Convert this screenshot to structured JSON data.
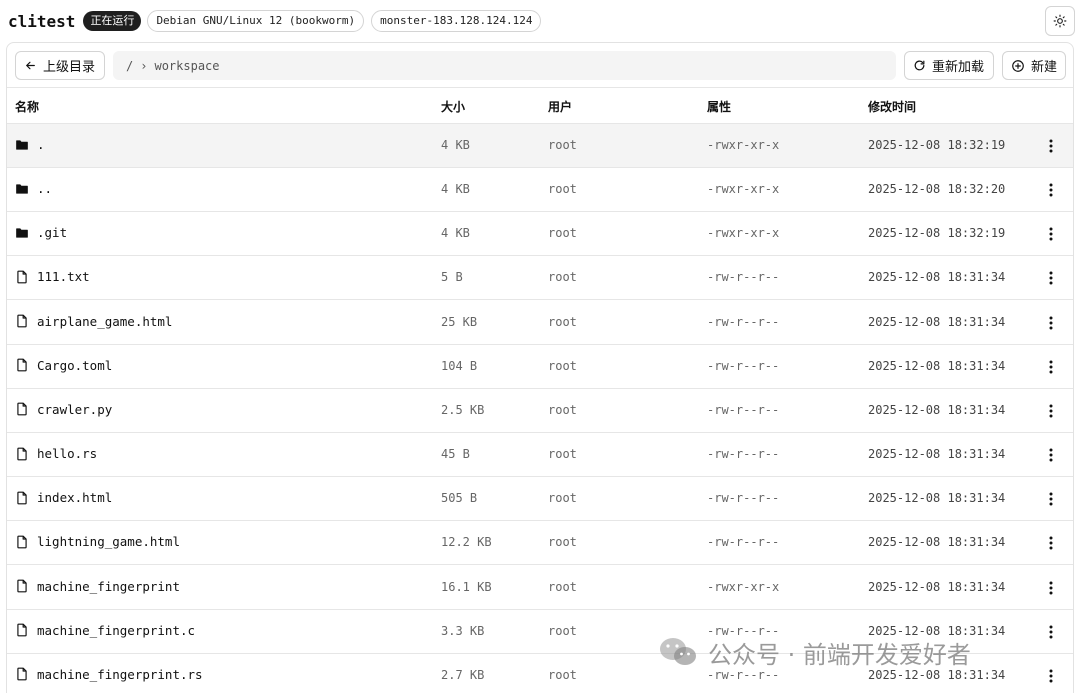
{
  "header": {
    "title": "clitest",
    "status": "正在运行",
    "os": "Debian GNU/Linux 12 (bookworm)",
    "host": "monster-183.128.124.124",
    "theme_icon": "sun-icon"
  },
  "toolbar": {
    "back_label": "上级目录",
    "path_root": "/",
    "path_separator": "›",
    "path_current": "workspace",
    "reload_label": "重新加载",
    "new_label": "新建"
  },
  "table": {
    "columns": [
      "名称",
      "大小",
      "用户",
      "属性",
      "修改时间"
    ],
    "rows": [
      {
        "type": "folder",
        "name": ".",
        "size": "4 KB",
        "user": "root",
        "perm": "-rwxr-xr-x",
        "time": "2025-12-08 18:32:19"
      },
      {
        "type": "folder",
        "name": "..",
        "size": "4 KB",
        "user": "root",
        "perm": "-rwxr-xr-x",
        "time": "2025-12-08 18:32:20"
      },
      {
        "type": "folder",
        "name": ".git",
        "size": "4 KB",
        "user": "root",
        "perm": "-rwxr-xr-x",
        "time": "2025-12-08 18:32:19"
      },
      {
        "type": "file",
        "name": "111.txt",
        "size": "5 B",
        "user": "root",
        "perm": "-rw-r--r--",
        "time": "2025-12-08 18:31:34"
      },
      {
        "type": "file",
        "name": "airplane_game.html",
        "size": "25 KB",
        "user": "root",
        "perm": "-rw-r--r--",
        "time": "2025-12-08 18:31:34"
      },
      {
        "type": "file",
        "name": "Cargo.toml",
        "size": "104 B",
        "user": "root",
        "perm": "-rw-r--r--",
        "time": "2025-12-08 18:31:34"
      },
      {
        "type": "file",
        "name": "crawler.py",
        "size": "2.5 KB",
        "user": "root",
        "perm": "-rw-r--r--",
        "time": "2025-12-08 18:31:34"
      },
      {
        "type": "file",
        "name": "hello.rs",
        "size": "45 B",
        "user": "root",
        "perm": "-rw-r--r--",
        "time": "2025-12-08 18:31:34"
      },
      {
        "type": "file",
        "name": "index.html",
        "size": "505 B",
        "user": "root",
        "perm": "-rw-r--r--",
        "time": "2025-12-08 18:31:34"
      },
      {
        "type": "file",
        "name": "lightning_game.html",
        "size": "12.2 KB",
        "user": "root",
        "perm": "-rw-r--r--",
        "time": "2025-12-08 18:31:34"
      },
      {
        "type": "file",
        "name": "machine_fingerprint",
        "size": "16.1 KB",
        "user": "root",
        "perm": "-rwxr-xr-x",
        "time": "2025-12-08 18:31:34"
      },
      {
        "type": "file",
        "name": "machine_fingerprint.c",
        "size": "3.3 KB",
        "user": "root",
        "perm": "-rw-r--r--",
        "time": "2025-12-08 18:31:34"
      },
      {
        "type": "file",
        "name": "machine_fingerprint.rs",
        "size": "2.7 KB",
        "user": "root",
        "perm": "-rw-r--r--",
        "time": "2025-12-08 18:31:34"
      }
    ]
  },
  "watermark": "公众号 · 前端开发爱好者"
}
